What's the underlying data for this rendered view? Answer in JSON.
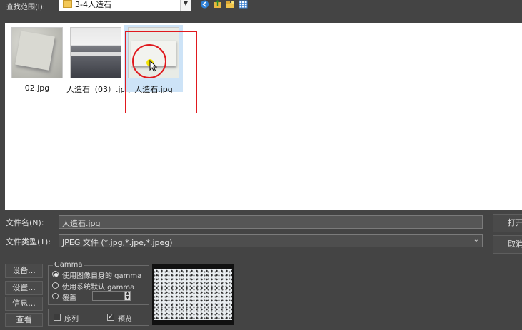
{
  "look_in": {
    "label": "查找范围(I):",
    "value": "3-4人造石"
  },
  "toolbar_icons": [
    "back-icon",
    "up-folder-icon",
    "new-folder-icon",
    "view-menu-icon"
  ],
  "files": [
    {
      "name": "02.jpg",
      "thumb": "marble-slab"
    },
    {
      "name": "人造石（03）.jpg",
      "thumb": "kitchen-counter"
    },
    {
      "name": "人造石.jpg",
      "thumb": "stone-sample",
      "selected": true
    }
  ],
  "file_name": {
    "label": "文件名(N):",
    "value": "人造石.jpg"
  },
  "file_type": {
    "label": "文件类型(T):",
    "value": "JPEG 文件 (*.jpg,*.jpe,*.jpeg)"
  },
  "buttons": {
    "open": "打开",
    "cancel": "取消"
  },
  "left_buttons": [
    "设备...",
    "设置...",
    "信息...",
    "查看"
  ],
  "gamma": {
    "title": "Gamma",
    "options": [
      "使用图像自身的 gamma",
      "使用系统默认 gamma",
      "覆盖"
    ],
    "selected_index": 0
  },
  "sequence_label": "序列",
  "preview_label": "预览",
  "sequence_checked": false,
  "preview_checked": true
}
